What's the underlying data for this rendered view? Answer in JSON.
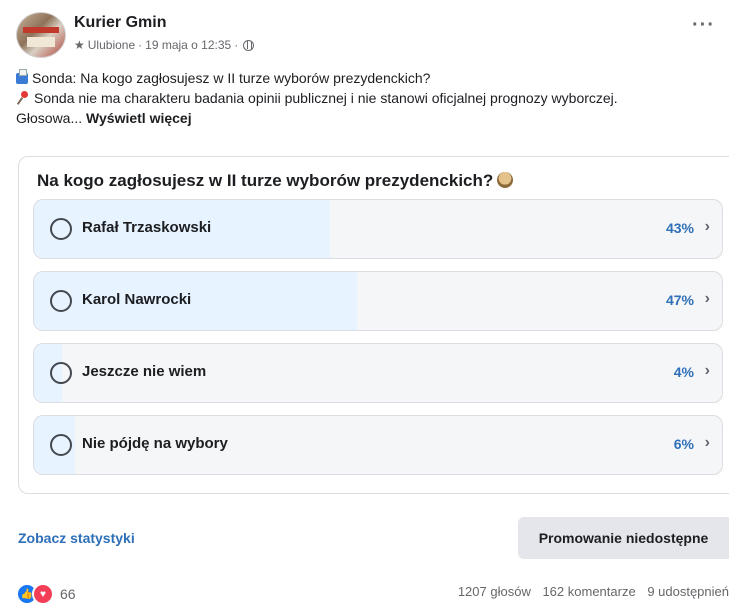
{
  "post": {
    "page_name": "Kurier Gmin",
    "meta_label": "Ulubione",
    "meta_date": "19 maja o 12:35",
    "more_icon": "more-horizontal-icon",
    "line1": "Sonda: Na kogo zagłosujesz w II turze wyborów prezydenckich?",
    "line2": "Sonda nie ma charakteru badania opinii publicznej i nie stanowi oficjalnej prognozy wyborczej.",
    "line3_prefix": "Głosowa...",
    "see_more": "Wyświetl więcej"
  },
  "poll": {
    "question": "Na kogo zagłosujesz w II turze wyborów prezydenckich?",
    "options": [
      {
        "label": "Rafał Trzaskowski",
        "percent_text": "43%",
        "percent": 43
      },
      {
        "label": "Karol Nawrocki",
        "percent_text": "47%",
        "percent": 47
      },
      {
        "label": "Jeszcze nie wiem",
        "percent_text": "4%",
        "percent": 4
      },
      {
        "label": "Nie pójdę na wybory",
        "percent_text": "6%",
        "percent": 6
      }
    ],
    "chevron": "›"
  },
  "actions": {
    "stats_link": "Zobacz statystyki",
    "promo_button": "Promowanie niedostępne"
  },
  "footer": {
    "reaction_count": "66",
    "votes": "1207 głosów",
    "comments": "162 komentarze",
    "shares": "9 udostępnień"
  },
  "colors": {
    "accent": "#2e6fb8",
    "option_fill": "#e7f3ff",
    "like": "#1877f2",
    "love": "#f33e58"
  }
}
